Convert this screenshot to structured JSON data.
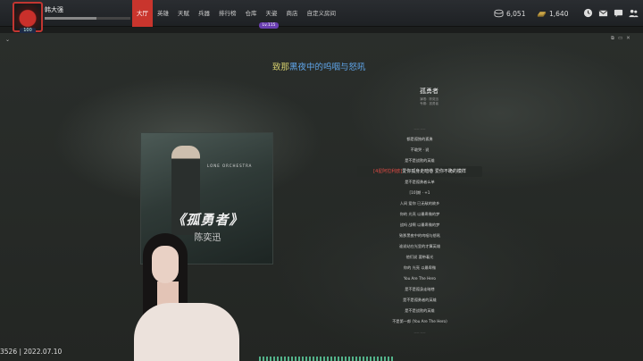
{
  "header": {
    "username": "韩大强",
    "avatar_level": "100",
    "xp_fraction": 0.6,
    "nav": [
      "大厅",
      "英雄",
      "天赋",
      "兵器",
      "排行榜",
      "仓库",
      "天姿",
      "商店",
      "自定义房间"
    ],
    "active_nav_index": 0,
    "level_tag": "Lv.115",
    "currencies": [
      {
        "icon": "coins-icon",
        "value": "6,051"
      },
      {
        "icon": "gold-bar-icon",
        "value": "1,640"
      }
    ],
    "system_icons": [
      "clock-icon",
      "mail-icon",
      "chat-icon",
      "people-icon",
      "settings-icon"
    ]
  },
  "main": {
    "headline_prefix": "致那",
    "headline_highlight": "黑夜中的呜咽与怒吼",
    "album": {
      "small_title": "LONE ORCHESTRA",
      "title": "《孤勇者》",
      "artist": "陈奕迅"
    },
    "song": {
      "title": "孤勇者",
      "meta_lines": [
        "演唱：陈奕迅",
        "专辑：孤勇者"
      ]
    },
    "lyrics": [
      {
        "text": "—— ——",
        "style": "dim"
      },
      {
        "text": "都是孤独的孤勇",
        "style": "normal"
      },
      {
        "text": "不敢哭 · 说",
        "style": "normal"
      },
      {
        "text": "是不是战败的英雄",
        "style": "normal"
      },
      {
        "prefix": "[4星阿拉利欧]",
        "text": "爱你孤身走暗巷 爱你不跪的模样",
        "style": "cur"
      },
      {
        "text": "是不是孤勇者么单",
        "style": "normal"
      },
      {
        "text": "[10]期 · +1",
        "style": "normal"
      },
      {
        "text": "人间 爱你 已无敌的故乡",
        "style": "normal"
      },
      {
        "text": "你的 光亮 以最卑微的梦",
        "style": "normal"
      },
      {
        "text": "战吗 战啊 以最卑微的梦",
        "style": "normal"
      },
      {
        "text": "致那黑夜中的呜咽与怒吼",
        "style": "normal"
      },
      {
        "text": "谁说站在光里的才算英雄",
        "style": "normal"
      },
      {
        "text": "他们说 要带着光",
        "style": "normal"
      },
      {
        "text": "你的 光亮 以最卑微",
        "style": "normal"
      },
      {
        "text": "You Are The Hero",
        "style": "normal"
      },
      {
        "text": "是不是孤身走暗巷",
        "style": "normal"
      },
      {
        "text": "是不是孤勇者的英雄",
        "style": "normal"
      },
      {
        "text": "是不是战败的英雄",
        "style": "normal"
      },
      {
        "text": "不是第一郎 (You Are The Hero)",
        "style": "normal"
      },
      {
        "text": "—— ——",
        "style": "dim"
      }
    ]
  },
  "watermark": "3526 | 2022.07.10"
}
